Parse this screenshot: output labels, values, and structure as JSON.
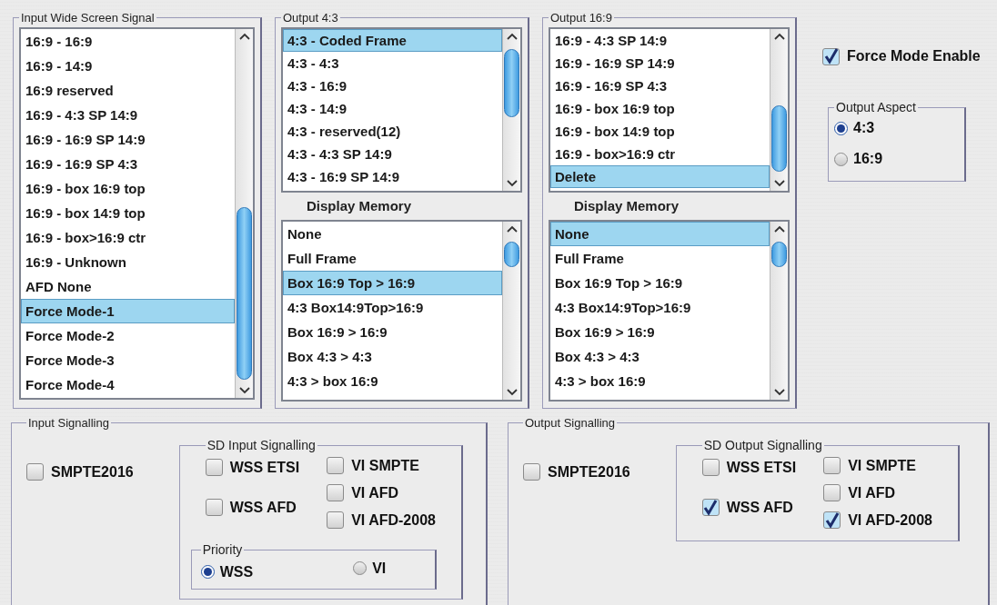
{
  "input_wss": {
    "title": "Input Wide Screen Signal",
    "items": [
      {
        "label": "16:9 - 16:9",
        "selected": false
      },
      {
        "label": "16:9 - 14:9",
        "selected": false
      },
      {
        "label": "16:9 reserved",
        "selected": false
      },
      {
        "label": "16:9 - 4:3 SP 14:9",
        "selected": false
      },
      {
        "label": "16:9 - 16:9 SP 14:9",
        "selected": false
      },
      {
        "label": "16:9 - 16:9 SP 4:3",
        "selected": false
      },
      {
        "label": "16:9 - box 16:9 top",
        "selected": false
      },
      {
        "label": "16:9 - box 14:9 top",
        "selected": false
      },
      {
        "label": "16:9 - box>16:9 ctr",
        "selected": false
      },
      {
        "label": "16:9 - Unknown",
        "selected": false
      },
      {
        "label": "AFD None",
        "selected": false
      },
      {
        "label": "Force Mode-1",
        "selected": true
      },
      {
        "label": "Force Mode-2",
        "selected": false
      },
      {
        "label": "Force Mode-3",
        "selected": false
      },
      {
        "label": "Force Mode-4",
        "selected": false
      }
    ]
  },
  "output_4_3": {
    "title": "Output 4:3",
    "items": [
      {
        "label": "4:3 - Coded Frame",
        "selected": true
      },
      {
        "label": "4:3 - 4:3",
        "selected": false
      },
      {
        "label": "4:3 - 16:9",
        "selected": false
      },
      {
        "label": "4:3 - 14:9",
        "selected": false
      },
      {
        "label": "4:3 - reserved(12)",
        "selected": false
      },
      {
        "label": "4:3 - 4:3 SP 14:9",
        "selected": false
      },
      {
        "label": "4:3 - 16:9 SP 14:9",
        "selected": false
      }
    ],
    "memory_label": "Display Memory",
    "memory_items": [
      {
        "label": "None",
        "selected": false
      },
      {
        "label": "Full Frame",
        "selected": false
      },
      {
        "label": "Box 16:9 Top > 16:9",
        "selected": true
      },
      {
        "label": "4:3 Box14:9Top>16:9",
        "selected": false
      },
      {
        "label": "Box 16:9 > 16:9",
        "selected": false
      },
      {
        "label": "Box 4:3 > 4:3",
        "selected": false
      },
      {
        "label": "4:3 > box 16:9",
        "selected": false
      }
    ]
  },
  "output_16_9": {
    "title": "Output 16:9",
    "items": [
      {
        "label": "16:9 - 4:3 SP 14:9",
        "selected": false
      },
      {
        "label": "16:9 - 16:9 SP 14:9",
        "selected": false
      },
      {
        "label": "16:9 - 16:9 SP 4:3",
        "selected": false
      },
      {
        "label": "16:9 - box 16:9 top",
        "selected": false
      },
      {
        "label": "16:9 - box 14:9 top",
        "selected": false
      },
      {
        "label": "16:9 - box>16:9 ctr",
        "selected": false
      },
      {
        "label": "Delete",
        "selected": true
      }
    ],
    "memory_label": "Display Memory",
    "memory_items": [
      {
        "label": "None",
        "selected": true
      },
      {
        "label": "Full Frame",
        "selected": false
      },
      {
        "label": "Box 16:9 Top > 16:9",
        "selected": false
      },
      {
        "label": "4:3 Box14:9Top>16:9",
        "selected": false
      },
      {
        "label": "Box 16:9 > 16:9",
        "selected": false
      },
      {
        "label": "Box 4:3 > 4:3",
        "selected": false
      },
      {
        "label": "4:3 > box 16:9",
        "selected": false
      }
    ]
  },
  "force_mode": {
    "label": "Force Mode Enable",
    "checked": true
  },
  "output_aspect": {
    "title": "Output Aspect",
    "options": [
      {
        "label": "4:3",
        "selected": true
      },
      {
        "label": "16:9",
        "selected": false
      }
    ]
  },
  "input_signalling": {
    "title": "Input Signalling",
    "smpte": {
      "label": "SMPTE2016",
      "checked": false
    },
    "sd": {
      "title": "SD Input Signalling",
      "columns": [
        [
          {
            "label": "WSS ETSI",
            "checked": false
          },
          {
            "label": "WSS AFD",
            "checked": false
          }
        ],
        [
          {
            "label": "VI SMPTE",
            "checked": false
          },
          {
            "label": "VI AFD",
            "checked": false
          },
          {
            "label": "VI AFD-2008",
            "checked": false
          }
        ]
      ],
      "priority": {
        "title": "Priority",
        "options": [
          {
            "label": "WSS",
            "selected": true
          },
          {
            "label": "VI",
            "selected": false
          }
        ]
      }
    }
  },
  "output_signalling": {
    "title": "Output Signalling",
    "smpte": {
      "label": "SMPTE2016",
      "checked": false
    },
    "sd": {
      "title": "SD Output Signalling",
      "columns": [
        [
          {
            "label": "WSS ETSI",
            "checked": false
          },
          {
            "label": "WSS AFD",
            "checked": true
          }
        ],
        [
          {
            "label": "VI SMPTE",
            "checked": false
          },
          {
            "label": "VI AFD",
            "checked": false
          },
          {
            "label": "VI AFD-2008",
            "checked": true
          }
        ]
      ]
    }
  }
}
